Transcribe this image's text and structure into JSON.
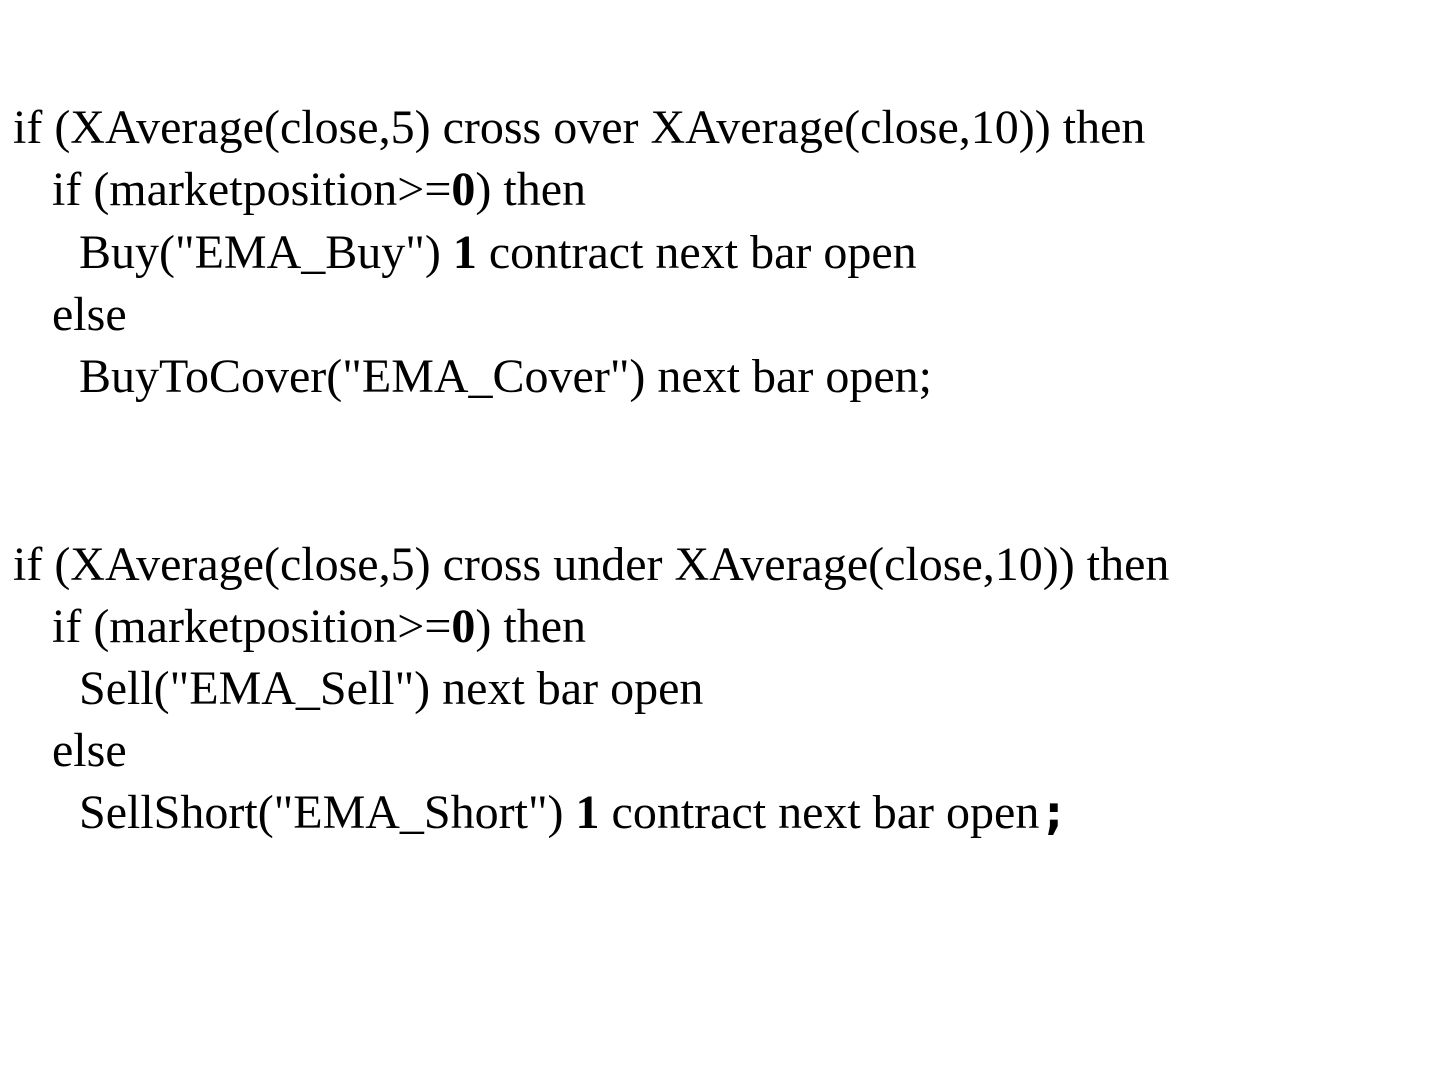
{
  "block1": {
    "line1": "if (XAverage(close,5) cross over XAverage(close,10)) then",
    "line2_pre": "if (marketposition>=",
    "line2_num": "0",
    "line2_post": ") then",
    "line3_pre": "Buy(\"EMA_Buy\") ",
    "line3_num": "1",
    "line3_post": " contract next bar open",
    "line4": "else",
    "line5": "BuyToCover(\"EMA_Cover\") next bar open;"
  },
  "block2": {
    "line1": "if (XAverage(close,5) cross under XAverage(close,10)) then",
    "line2_pre": "if (marketposition>=",
    "line2_num": "0",
    "line2_post": ") then",
    "line3": "Sell(\"EMA_Sell\") next bar open",
    "line4": "else",
    "line5_pre": "SellShort(\"EMA_Short\") ",
    "line5_num": "1",
    "line5_post": " contract next bar open",
    "line5_end": ";"
  }
}
